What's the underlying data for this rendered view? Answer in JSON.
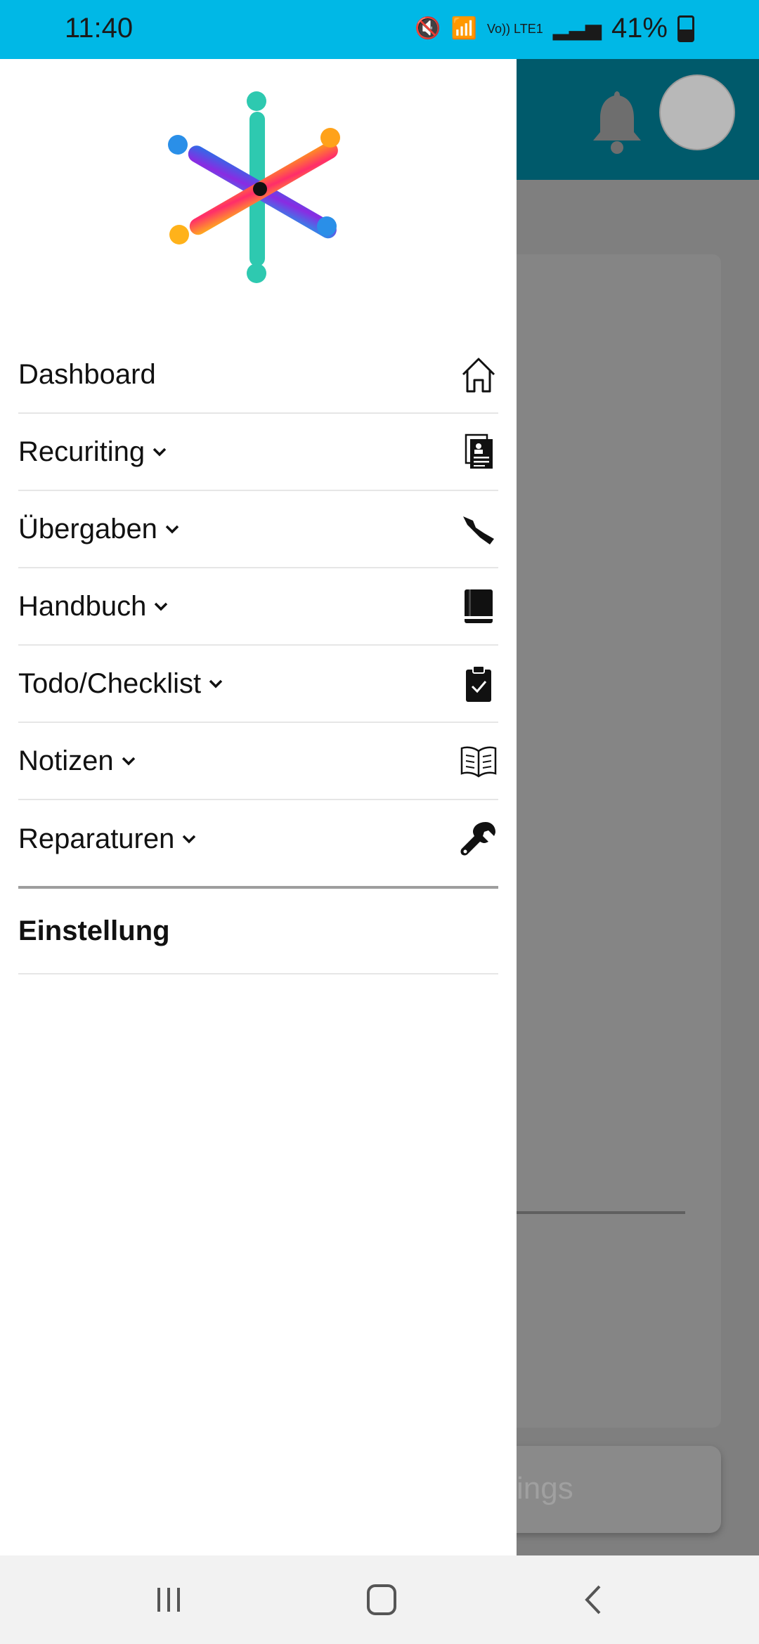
{
  "status": {
    "time": "11:40",
    "battery": "41%",
    "network": "Vo)) LTE1",
    "battery_level": 0.41
  },
  "drawer": {
    "items": [
      {
        "label": "Dashboard",
        "icon": "home-icon",
        "expandable": false
      },
      {
        "label": "Recuriting",
        "icon": "resume-document-icon",
        "expandable": true
      },
      {
        "label": "Übergaben",
        "icon": "handover-icon",
        "expandable": true
      },
      {
        "label": "Handbuch",
        "icon": "book-icon",
        "expandable": true
      },
      {
        "label": "Todo/Checklist",
        "icon": "clipboard-check-icon",
        "expandable": true
      },
      {
        "label": "Notizen",
        "icon": "open-book-icon",
        "expandable": true
      },
      {
        "label": "Reparaturen",
        "icon": "wrench-icon",
        "expandable": true
      }
    ],
    "settings_label": "Einstellung"
  },
  "background": {
    "bottom_button_text": "ings"
  },
  "colors": {
    "status_bar": "#00b8e6",
    "header": "#005a6b",
    "scrim": "#7f7f7f"
  }
}
